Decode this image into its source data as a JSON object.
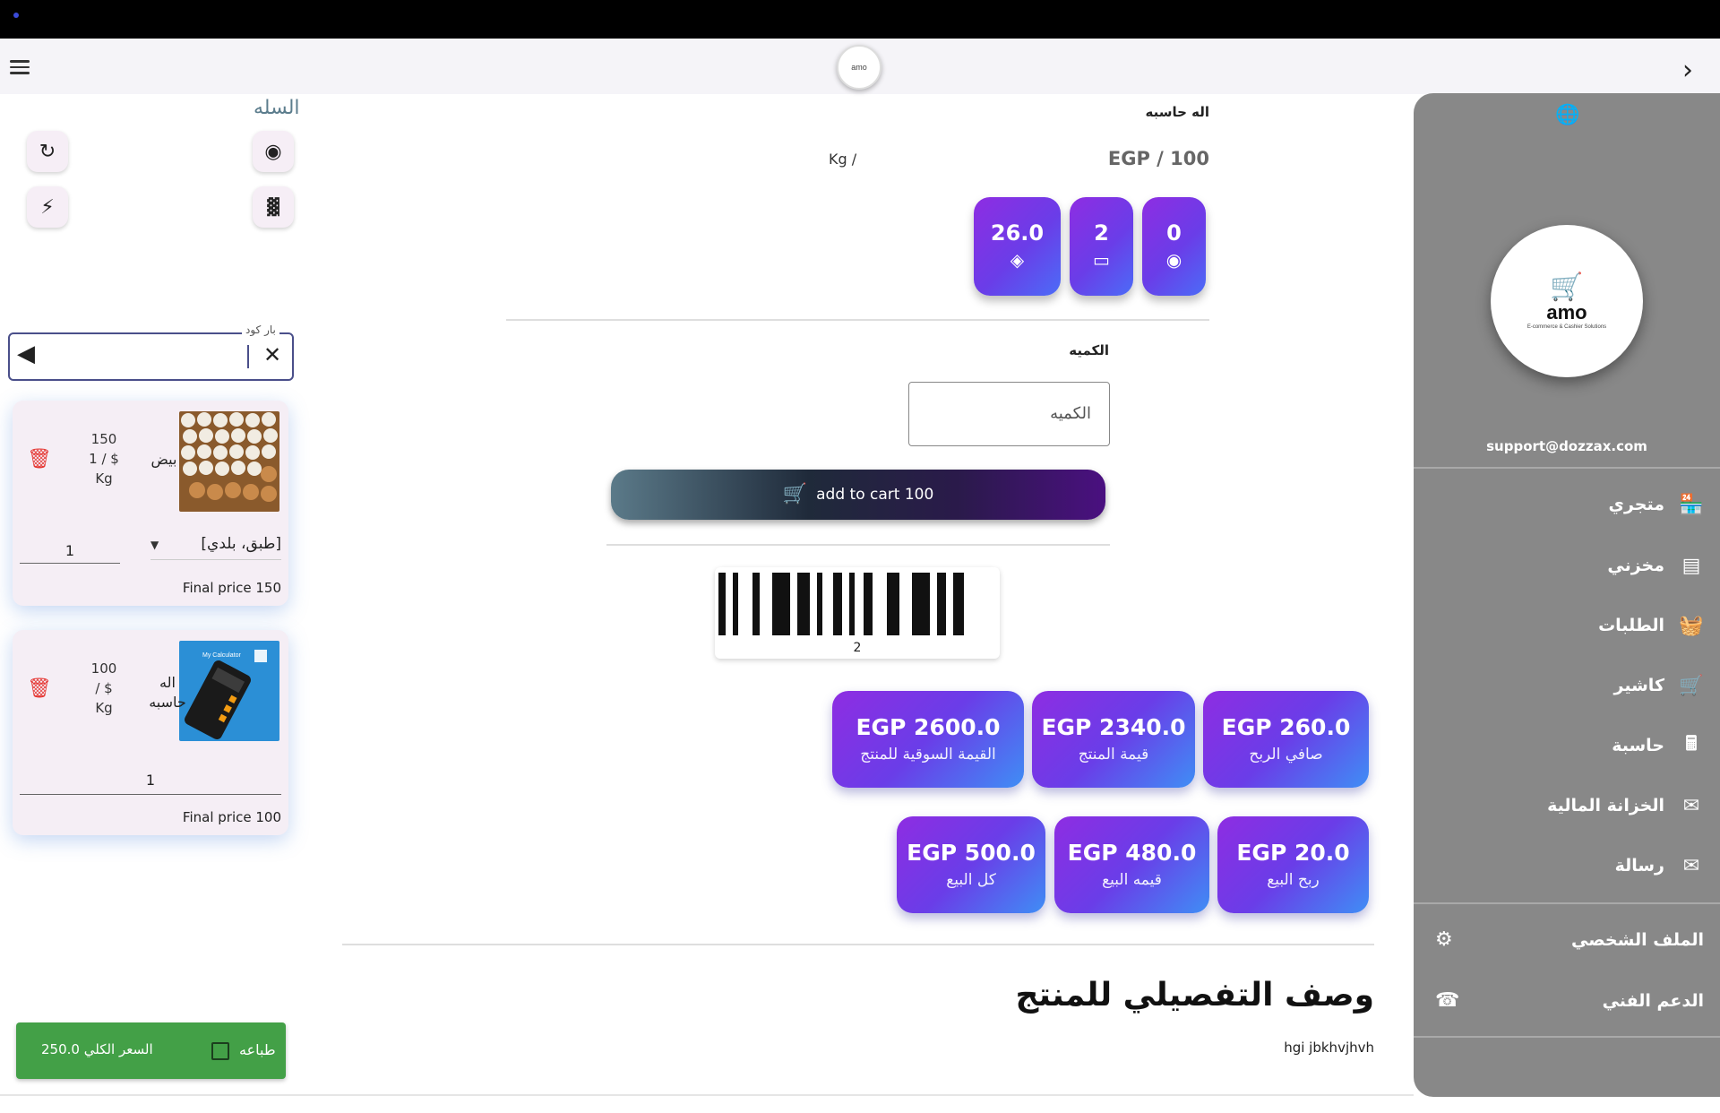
{
  "appbar": {
    "logo_text": "amo"
  },
  "cart": {
    "title": "السله",
    "search": {
      "legend": "بار كود",
      "value": ""
    },
    "items": [
      {
        "name": "بيض",
        "qty_price": "150",
        "price_line": "1 / $",
        "unit": "Kg",
        "variant": "[طبق، بلدي]",
        "quantity": "1",
        "final": "Final price 150"
      },
      {
        "name": "اله حاسبه",
        "qty_price": "100",
        "price_line": "/ $",
        "unit": "Kg",
        "quantity": "1",
        "final": "Final price 100",
        "image_caption": "My Calculator"
      }
    ],
    "total_label": "السعر الكلي 250.0",
    "print_label": "طباعه"
  },
  "product": {
    "name": "اله حاسبه",
    "unit": "Kg  /",
    "price": "EGP / 100",
    "stats": [
      {
        "value": "26.0",
        "icon": "layers-icon"
      },
      {
        "value": "2",
        "icon": "card-icon"
      },
      {
        "value": "0",
        "icon": "eye-icon"
      }
    ],
    "qty_label": "الكميه",
    "qty_placeholder": "الكميه",
    "add_to_cart": "add to cart 100",
    "barcode_number": "2",
    "tiles_row1": [
      {
        "value": "EGP  2600.0",
        "label": "القيمة السوقية للمنتج"
      },
      {
        "value": "EGP 2340.0",
        "label": "قيمة المنتج"
      },
      {
        "value": "EGP   260.0",
        "label": "صافي الربح"
      }
    ],
    "tiles_row2": [
      {
        "value": "EGP 500.0",
        "label": "كل البيع"
      },
      {
        "value": "EGP  480.0",
        "label": "قيمه البيع"
      },
      {
        "value": "EGP   20.0",
        "label": "ربح البيع"
      }
    ],
    "desc_title": "وصف التفصيلي للمنتج",
    "desc_text": "hgi jbkhvjhvh"
  },
  "sidebar": {
    "logo_word": "amo",
    "logo_tagline": "E-commerce & Cashier Solutions",
    "email": "support@dozzax.com",
    "menu": [
      {
        "label": "متجري",
        "icon": "store-icon"
      },
      {
        "label": "مخزني",
        "icon": "warehouse-icon"
      },
      {
        "label": "الطلبات",
        "icon": "basket-icon"
      },
      {
        "label": "كاشير",
        "icon": "cart-icon"
      },
      {
        "label": "حاسبة",
        "icon": "calculator-icon"
      },
      {
        "label": "الخزانة المالية",
        "icon": "message-icon"
      },
      {
        "label": "رسالة",
        "icon": "message-icon"
      }
    ],
    "profile": "الملف الشخصي",
    "support": "الدعم الفني"
  }
}
